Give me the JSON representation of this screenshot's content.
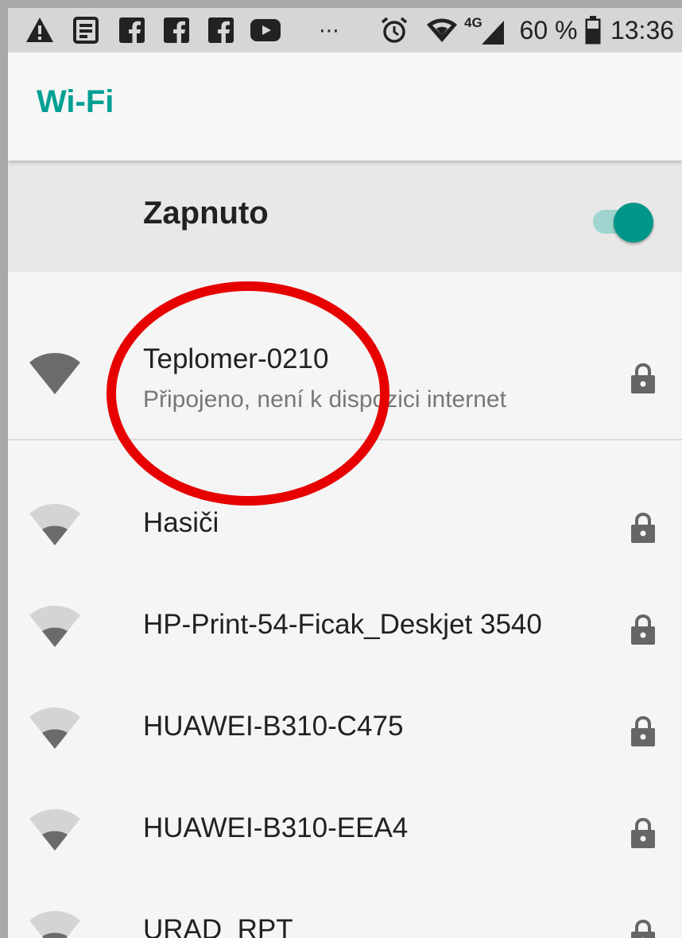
{
  "status_bar": {
    "more": "⋯",
    "network": "4G",
    "battery": "60 %",
    "time": "13:36"
  },
  "app_bar": {
    "title": "Wi-Fi"
  },
  "master_switch": {
    "label": "Zapnuto",
    "on": true
  },
  "connected_network": {
    "name": "Teplomer-0210",
    "status": "Připojeno, není k dispozici internet",
    "secured": true
  },
  "networks": [
    {
      "name": "Hasiči",
      "secured": true
    },
    {
      "name": "HP-Print-54-Ficak_Deskjet 3540",
      "secured": true
    },
    {
      "name": "HUAWEI-B310-C475",
      "secured": true
    },
    {
      "name": "HUAWEI-B310-EEA4",
      "secured": true
    },
    {
      "name": "URAD_RPT",
      "secured": true
    }
  ],
  "colors": {
    "accent": "#00a093",
    "switch_thumb": "#009688",
    "annotation": "#e60000"
  }
}
